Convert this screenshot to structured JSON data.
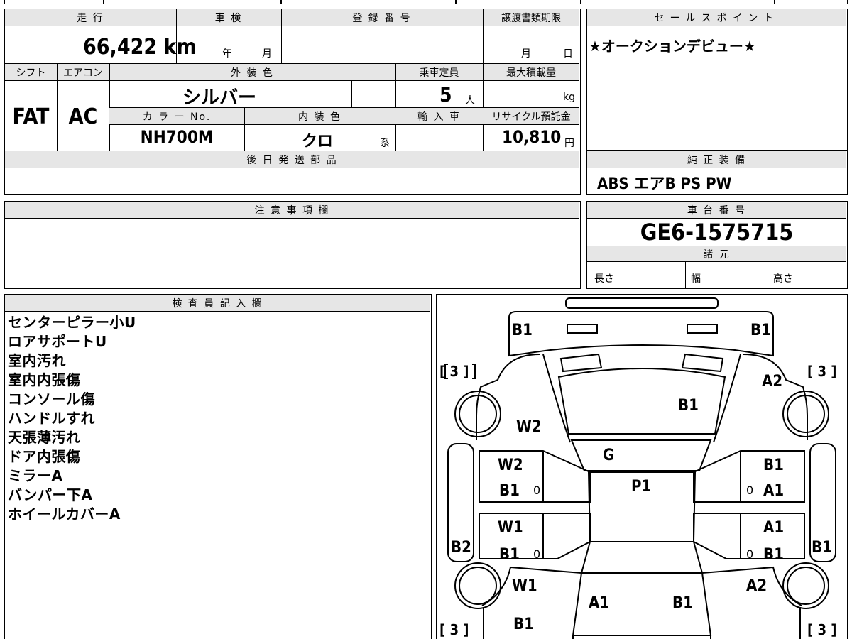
{
  "vehicle": {
    "mileage_label": "走 行",
    "mileage_value": "66,422",
    "mileage_unit": "km",
    "shaken_label": "車 検",
    "shaken_year": "年",
    "shaken_month": "月",
    "reg_label": "登 録 番 号",
    "transfer_label": "譲渡書類期限",
    "transfer_month": "月",
    "transfer_day": "日",
    "shift_label": "シフト",
    "shift_value": "FAT",
    "ac_label": "エアコン",
    "ac_value": "AC",
    "exterior_label": "外 装 色",
    "exterior_value": "シルバー",
    "capacity_label": "乗車定員",
    "capacity_value": "5",
    "capacity_unit": "人",
    "load_label": "最大積載量",
    "load_unit": "kg",
    "color_no_label": "カ ラ ー No.",
    "color_no_value": "NH700M",
    "interior_label": "内 装 色",
    "interior_value": "クロ",
    "interior_unit": "系",
    "import_label": "輸 入 車",
    "recycle_label": "リサイクル預託金",
    "recycle_value": "10,810",
    "recycle_unit": "円",
    "later_parts_label": "後 日 発 送 部 品"
  },
  "selling_points": {
    "label": "セールスポイント",
    "value": "★オークションデビュー★"
  },
  "equipment": {
    "label": "純 正 装 備",
    "value": "ABS エアB PS PW"
  },
  "caution": {
    "label": "注 意 事 項 欄"
  },
  "chassis": {
    "label": "車 台 番 号",
    "value": "GE6-1575715",
    "spec_label": "諸 元",
    "length_label": "長さ",
    "width_label": "幅",
    "height_label": "高さ"
  },
  "inspector": {
    "label": "検 査 員 記 入 欄",
    "notes": [
      "センターピラー小U",
      "ロアサポートU",
      "室内汚れ",
      "室内内張傷",
      "コンソール傷",
      "ハンドルすれ",
      "天張薄汚れ",
      "ドア内張傷",
      "ミラーA",
      "バンパー下A",
      "ホイールカバーA"
    ]
  },
  "diagram": {
    "marks": {
      "front_left": "B1",
      "front_right": "B1",
      "tire_fl": "[ 3 ]",
      "tire_fr": "[ 3 ]",
      "tire_rl": "[ 3 ]",
      "tire_rr": "[ 3 ]",
      "fender_fr": "A2",
      "hood": "B1",
      "fender_fl": "W2",
      "windshield": "G",
      "door_fl_top": "W2",
      "door_fl_bottom": "B1",
      "door_fr_top": "B1",
      "door_fr_bottom": "A1",
      "roof": "P1",
      "door_rl_top": "W1",
      "door_rl_bottom": "B1",
      "door_rr_top": "A1",
      "door_rr_bottom": "B1",
      "sill_left": "B2",
      "sill_right": "B1",
      "fender_rl": "W1",
      "fender_rr": "A2",
      "trunk_left": "A1",
      "trunk_right": "B1",
      "rear_left": "B1",
      "zero_1": "0",
      "zero_2": "0",
      "zero_3": "0",
      "zero_4": "0"
    }
  }
}
